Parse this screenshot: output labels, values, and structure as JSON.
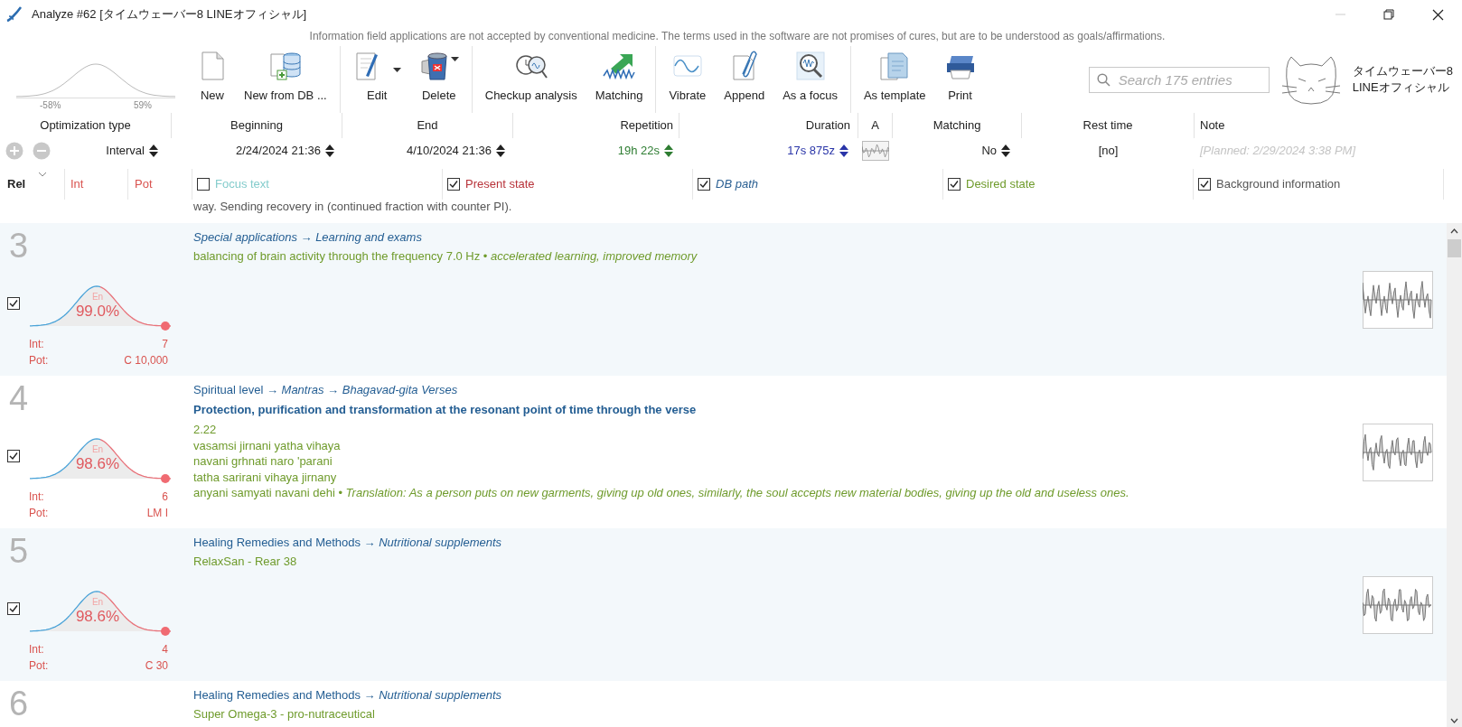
{
  "window": {
    "title": "Analyze #62 [タイムウェーバー8 LINEオフィシャル]"
  },
  "disclaimer": "Information field applications are not accepted by conventional medicine. The terms used in the software are not promises of cures, but are to be understood as goals/affirmations.",
  "distribution": {
    "low": "-58%",
    "high": "59%"
  },
  "toolbar_groups": [
    [
      {
        "label": "New",
        "has_menu": false
      },
      {
        "label": "New from DB ...",
        "has_menu": false
      }
    ],
    [
      {
        "label": "Edit",
        "has_menu": true
      },
      {
        "label": "Delete",
        "has_menu": true
      }
    ],
    [
      {
        "label": "Checkup analysis",
        "has_menu": false
      },
      {
        "label": "Matching",
        "has_menu": false
      }
    ],
    [
      {
        "label": "Vibrate",
        "has_menu": false
      },
      {
        "label": "Append",
        "has_menu": false
      },
      {
        "label": "As a focus",
        "has_menu": false
      }
    ],
    [
      {
        "label": "As template",
        "has_menu": false
      },
      {
        "label": "Print",
        "has_menu": false
      }
    ]
  ],
  "search": {
    "placeholder": "Search 175 entries"
  },
  "brand": [
    "タイムウェーバー8",
    "LINEオフィシャル"
  ],
  "settings": [
    {
      "header": "Optimization type",
      "value": "Interval",
      "kind": "spinner"
    },
    {
      "header": "Beginning",
      "value": "2/24/2024 21:36",
      "kind": "spinner"
    },
    {
      "header": "End",
      "value": "4/10/2024 21:36",
      "kind": "spinner"
    },
    {
      "header": "Repetition",
      "value": "19h 22s",
      "kind": "spinner"
    },
    {
      "header": "Duration",
      "value": "17s 875z",
      "kind": "spinner"
    },
    {
      "header": "A",
      "kind": "wave"
    },
    {
      "header": "Matching",
      "value": "No",
      "kind": "spinner"
    },
    {
      "header": "Rest time",
      "value": "[no]",
      "kind": "text"
    },
    {
      "header": "Note",
      "value": "[Planned: 2/29/2024 3:38 PM]",
      "kind": "note"
    }
  ],
  "list_header": {
    "sort_label": "Rel",
    "int_label": "Int",
    "pot_label": "Pot",
    "filters": [
      {
        "label": "Focus text",
        "checked": false
      },
      {
        "label": "Present state",
        "checked": true
      },
      {
        "label": "DB path",
        "checked": true
      },
      {
        "label": "Desired state",
        "checked": true
      },
      {
        "label": "Background information",
        "checked": true
      }
    ]
  },
  "overflow_text": "way. Sending recovery in (continued fraction with counter PI).",
  "entries": [
    {
      "number": "3",
      "checked": true,
      "en_label": "En",
      "percent": "99.0%",
      "int_label": "Int:",
      "int": "7",
      "pot_label": "Pot:",
      "pot": "C 10,000",
      "path": "Special applications → Learning and exams",
      "path_italic": true,
      "lines": [
        "balancing of brain activity through the frequency 7.0 Hz • *accelerated learning, improved memory*"
      ]
    },
    {
      "number": "4",
      "checked": true,
      "en_label": "En",
      "percent": "98.6%",
      "int_label": "Int:",
      "int": "6",
      "pot_label": "Pot:",
      "pot": "LM I",
      "path": "Spiritual level → *Mantras → Bhagavad-gita Verses*",
      "path_italic": false,
      "title": "Protection, purification and transformation at the resonant point of time through the verse",
      "lines": [
        "2.22",
        "vasamsi jirnani yatha vihaya",
        "navani grhnati naro 'parani",
        "tatha sarirani vihaya jirnany",
        "anyani samyati navani dehi • *Translation: As a person puts on new garments, giving up old ones, similarly, the soul accepts new material bodies, giving up the old and useless ones.*"
      ]
    },
    {
      "number": "5",
      "checked": true,
      "en_label": "En",
      "percent": "98.6%",
      "int_label": "Int:",
      "int": "4",
      "pot_label": "Pot:",
      "pot": "C 30",
      "path": "Healing Remedies and Methods → *Nutritional supplements*",
      "path_italic": false,
      "lines": [
        "RelaxSan - Rear 38"
      ]
    },
    {
      "number": "6",
      "path": "Healing Remedies and Methods → *Nutritional supplements*",
      "path_italic": false,
      "lines": [
        "Super Omega-3 - pro-nutraceutical"
      ]
    }
  ]
}
